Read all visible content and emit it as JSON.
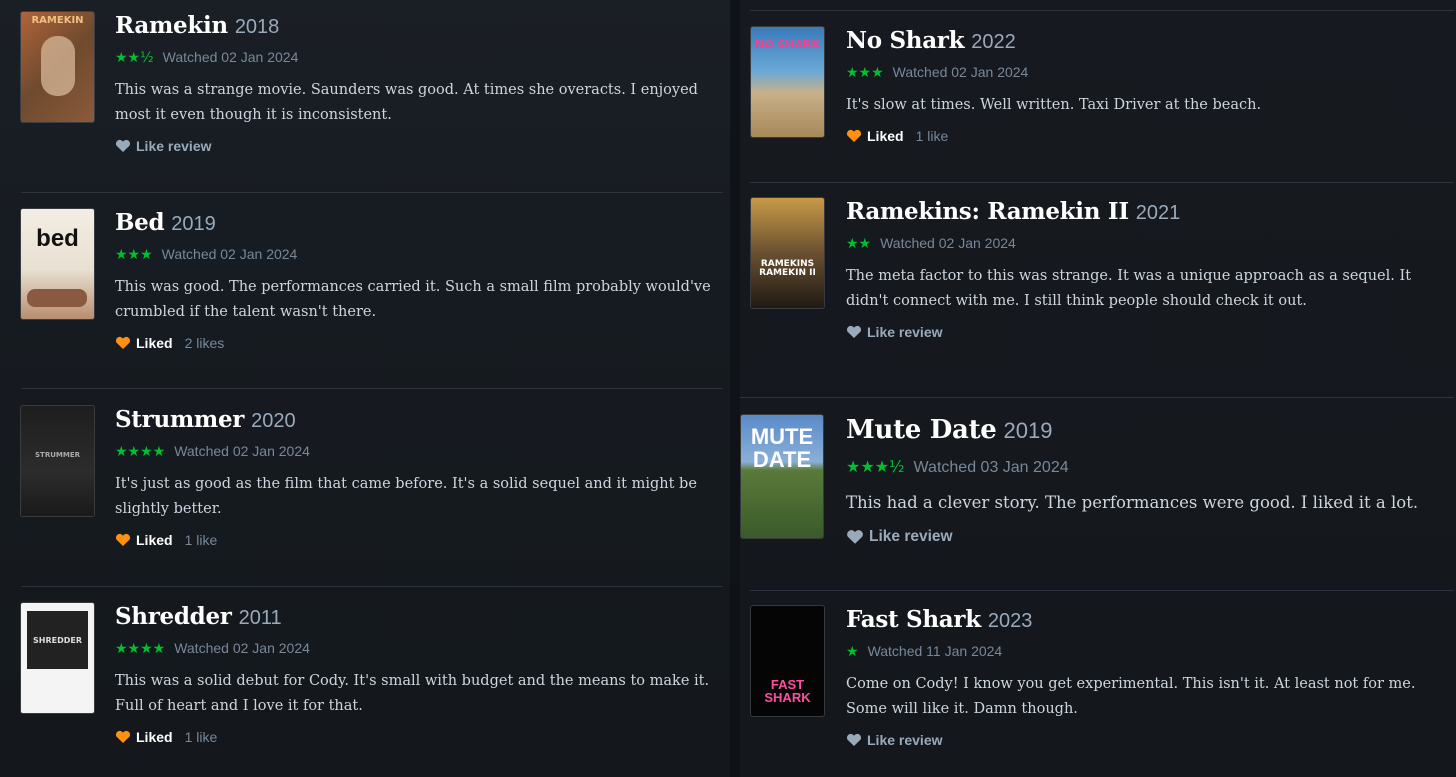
{
  "left": [
    {
      "title": "Ramekin",
      "year": "2018",
      "stars": "★★½",
      "watched": "Watched 02 Jan 2024",
      "text": "This was a strange movie. Saunders was good. At times she overacts. I enjoyed most it even though it is inconsistent.",
      "action": "Like review",
      "liked": false,
      "likes": "",
      "poster_text": "RAMEKIN"
    },
    {
      "title": "Bed",
      "year": "2019",
      "stars": "★★★",
      "watched": "Watched 02 Jan 2024",
      "text": "This was good. The performances carried it. Such a small film probably would've crumbled if the talent wasn't there.",
      "action": "Liked",
      "liked": true,
      "likes": "2 likes",
      "poster_text": "bed"
    },
    {
      "title": "Strummer",
      "year": "2020",
      "stars": "★★★★",
      "watched": "Watched 02 Jan 2024",
      "text": "It's just as good as the film that came before. It's a solid sequel and it might be slightly better.",
      "action": "Liked",
      "liked": true,
      "likes": "1 like",
      "poster_text": "STRUMMER"
    },
    {
      "title": "Shredder",
      "year": "2011",
      "stars": "★★★★",
      "watched": "Watched 02 Jan 2024",
      "text": "This was a solid debut for Cody. It's small with budget and the means to make it. Full of heart and I love it for that.",
      "action": "Liked",
      "liked": true,
      "likes": "1 like",
      "poster_text": "SHREDDER"
    }
  ],
  "right": [
    {
      "title": "No Shark",
      "year": "2022",
      "stars": "★★★",
      "watched": "Watched 02 Jan 2024",
      "text": "It's slow at times. Well written. Taxi Driver at the beach.",
      "action": "Liked",
      "liked": true,
      "likes": "1 like",
      "poster_text": "NO SHARK"
    },
    {
      "title": "Ramekins: Ramekin II",
      "year": "2021",
      "stars": "★★",
      "watched": "Watched 02 Jan 2024",
      "text": "The meta factor to this was strange. It was a unique approach as a sequel. It didn't connect with me. I still think people should check it out.",
      "action": "Like review",
      "liked": false,
      "likes": "",
      "poster_text": "RAMEKINS\nRAMEKIN II"
    },
    {
      "title": "Mute Date",
      "year": "2019",
      "stars": "★★★½",
      "watched": "Watched 03 Jan 2024",
      "text": "This had a clever story. The performances were good. I liked it a lot.",
      "action": "Like review",
      "liked": false,
      "likes": "",
      "poster_text": "MUTE\nDATE"
    },
    {
      "title": "Fast Shark",
      "year": "2023",
      "stars": "★",
      "watched": "Watched 11 Jan 2024",
      "text": "Come on Cody! I know you get experimental. This isn't it. At least not for me. Some will like it. Damn though.",
      "action": "Like review",
      "liked": false,
      "likes": "",
      "poster_text": "FAST\nSHARK"
    }
  ],
  "colors": {
    "star": "#00c030",
    "heart_liked": "#ff9010",
    "heart_unliked": "#99aabb",
    "background": "#14181c"
  }
}
